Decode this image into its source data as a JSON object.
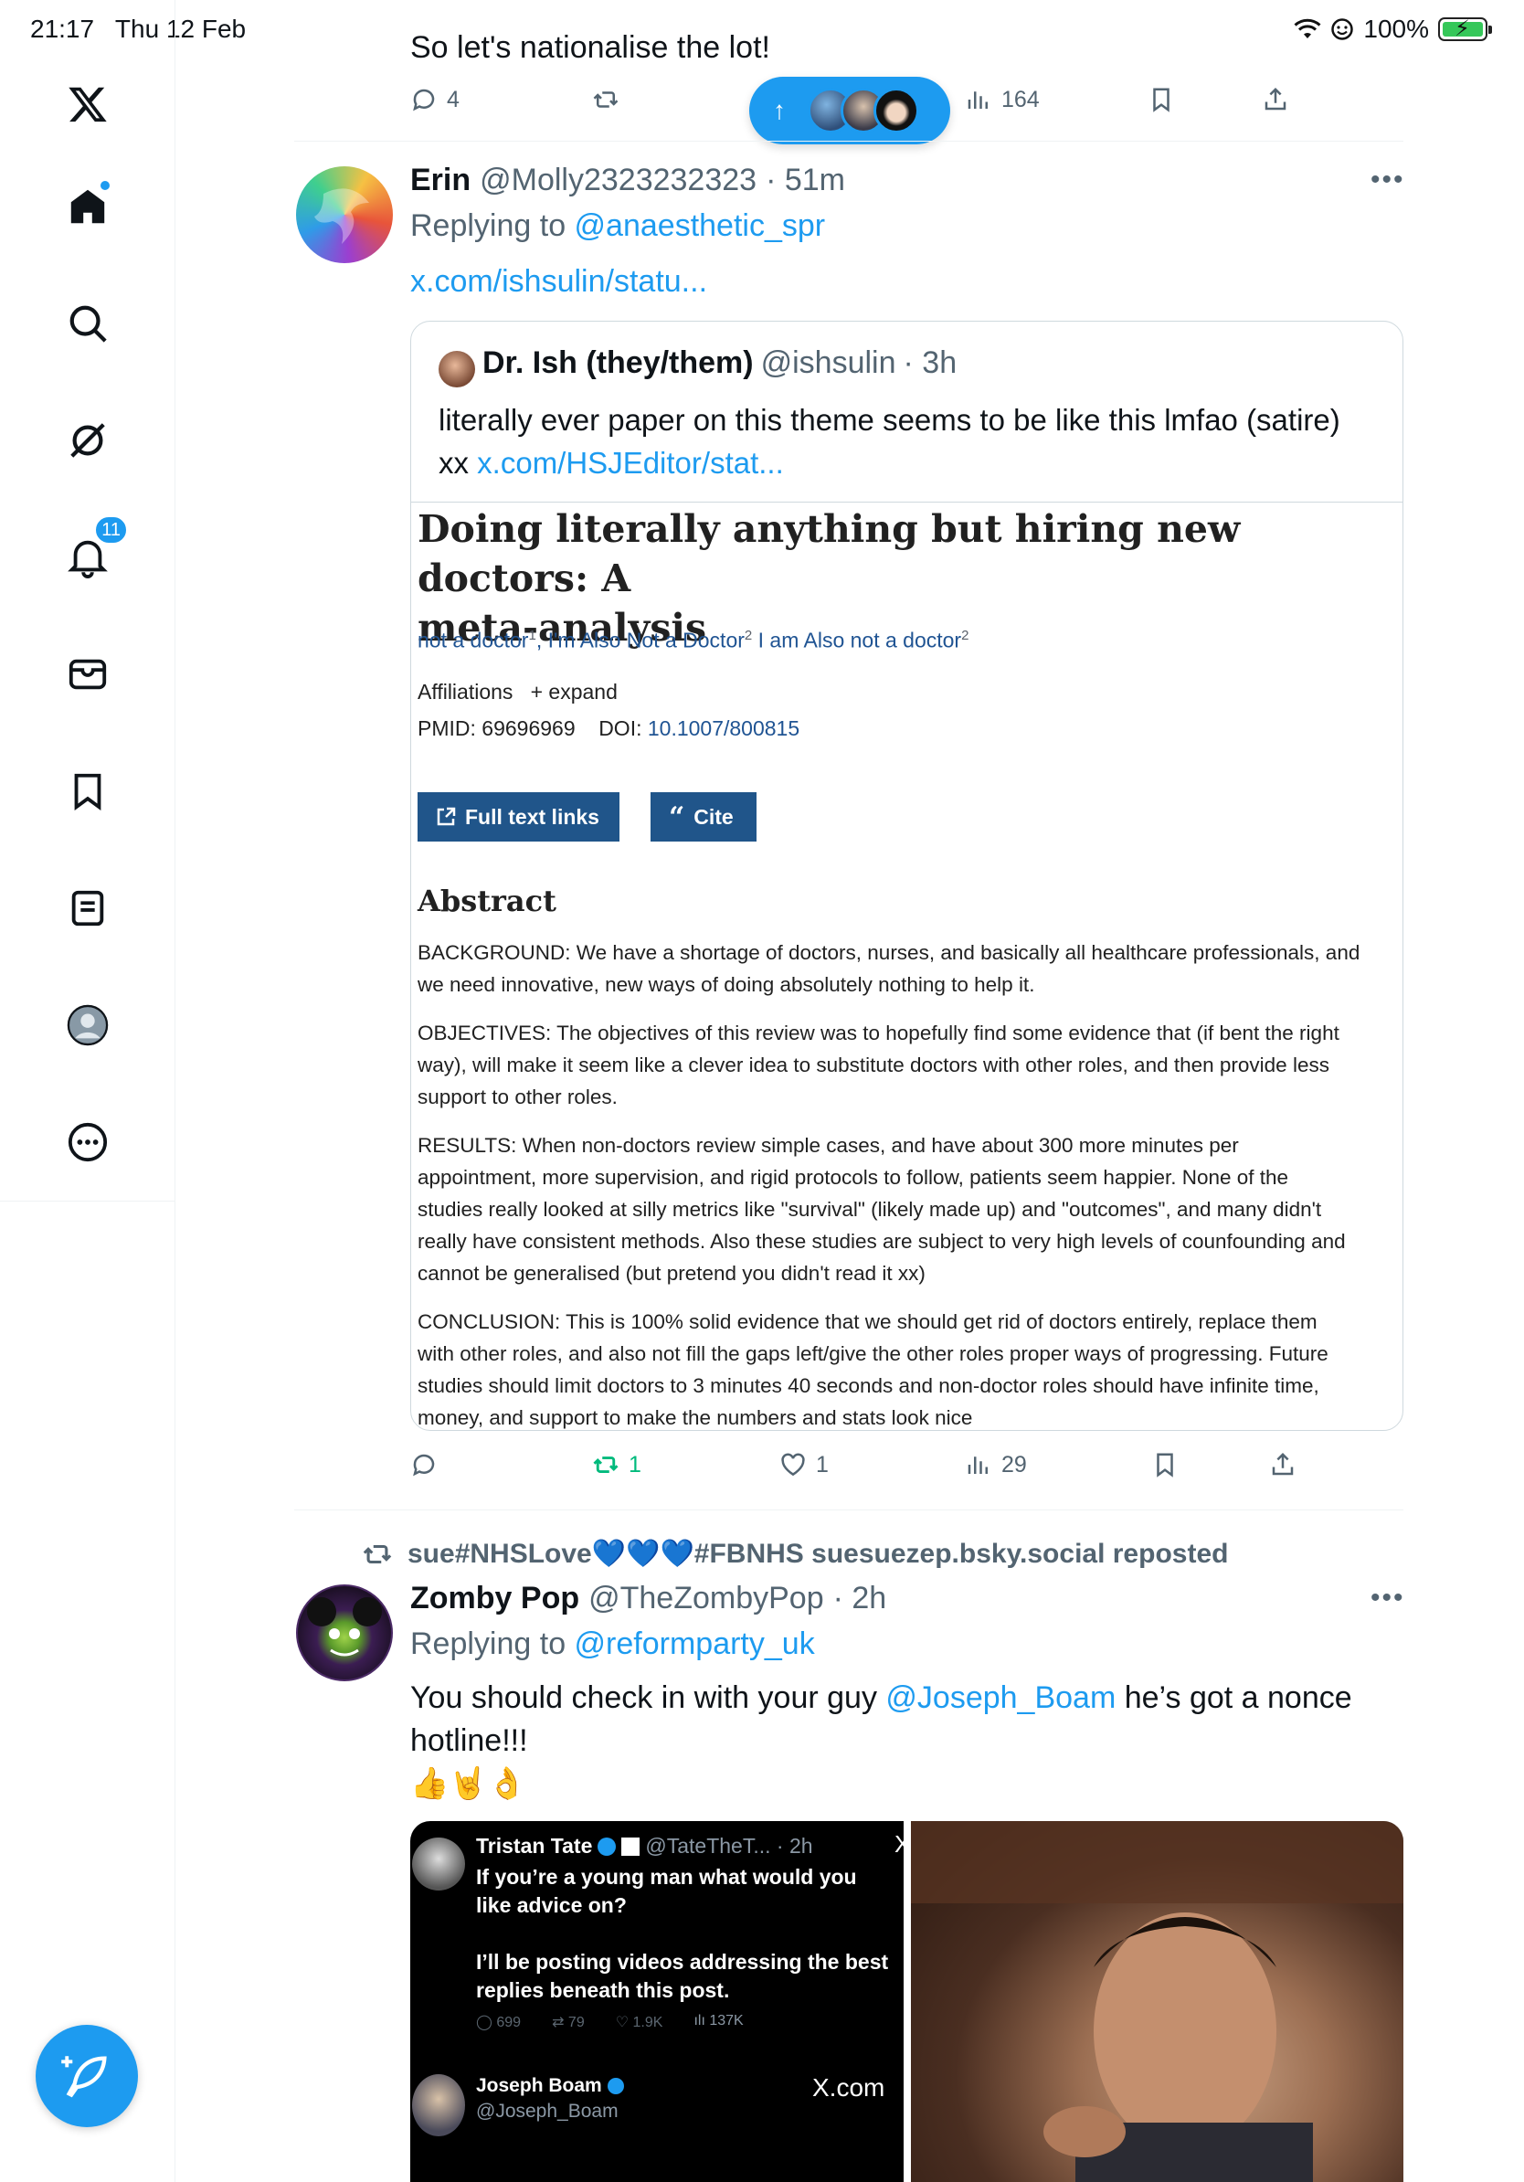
{
  "status_bar": {
    "time": "21:17",
    "date": "Thu 12 Feb",
    "battery": "100%"
  },
  "sidebar": {
    "notifications_badge": "11"
  },
  "new_posts_pill": {
    "arrow": "↑"
  },
  "post0": {
    "text": "So let's nationalise the lot!",
    "replies": "4",
    "views": "164"
  },
  "post1": {
    "name": "Erin",
    "handle": "@Molly2323232323",
    "time": "· 51m",
    "replying_prefix": "Replying to ",
    "replying_to": "@anaesthetic_spr",
    "link": "x.com/ishsulin/statu...",
    "replies": "",
    "reposts": "1",
    "likes": "1",
    "views": "29"
  },
  "quote": {
    "name": "Dr. Ish (they/them)",
    "handle": "@ishsulin",
    "time": "· 3h",
    "text_line1": "literally ever paper on this theme seems to be like this lmfao (satire)",
    "text_line2_prefix": "xx ",
    "text_link": "x.com/HSJEditor/stat...",
    "paper": {
      "title_line1": "Doing literally anything but hiring new doctors: A",
      "title_line2": "meta-analysis",
      "author1": "not a doctor",
      "author1_sup": "1",
      "author2": "I'm Also Not a Doctor",
      "author2_sup": "2",
      "author3": "I am Also not a doctor",
      "author3_sup": "2",
      "affiliations": "Affiliations",
      "expand": "+ expand",
      "pmid_label": "PMID: 69696969",
      "doi_label": "DOI:",
      "doi_value": "10.1007/800815",
      "btn_full_text": "Full text links",
      "btn_cite": "Cite",
      "abstract_heading": "Abstract",
      "background_l1": "BACKGROUND: We have a shortage of doctors, nurses, and basically all healthcare professionals, and",
      "background_l2": "we need innovative, new ways of doing absolutely nothing to help it.",
      "objectives_l1": "OBJECTIVES: The objectives of this review was to hopefully find some evidence that (if bent the right",
      "objectives_l2": "way), will make it seem like a clever idea to substitute doctors with other roles, and then provide less",
      "objectives_l3": "support to other roles.",
      "results_l1": "RESULTS: When non-doctors review simple cases, and have about 300 more minutes per",
      "results_l2": "appointment, more supervision, and rigid protocols to follow, patients seem happier. None of the",
      "results_l3": "studies really looked at silly metrics like \"survival\" (likely made up) and \"outcomes\", and many didn't",
      "results_l4": "really have consistent methods. Also these studies are subject to very high levels of counfounding and",
      "results_l5": "cannot be generalised (but pretend you didn't read it xx)",
      "conclusion_l1": "CONCLUSION: This is 100% solid evidence that we should get rid of doctors entirely, replace them",
      "conclusion_l2": "with other roles, and also not fill the gaps left/give the other roles proper ways of progressing. Future",
      "conclusion_l3": "studies should limit doctors to 3 minutes 40 seconds and non-doctor roles should have infinite time,",
      "conclusion_l4": "money, and support to make the numbers and stats look nice"
    }
  },
  "post2": {
    "repost_line": "sue#NHSLove💙💙💙#FBNHS suesuezep.bsky.social reposted",
    "name": "Zomby Pop",
    "handle": "@TheZombyPop",
    "time": "· 2h",
    "replying_prefix": "Replying to ",
    "replying_to": "@reformparty_uk",
    "text_a": "You should check in with your guy ",
    "text_mention": "@Joseph_Boam",
    "text_b": " he’s got a nonce",
    "text_line2": "hotline!!!",
    "emojis": "👍🤘👌",
    "media": {
      "tweet_name": "Tristan Tate",
      "tweet_handle": "@TateTheT... · 2h",
      "tweet_text1": "If you’re a young man what would you",
      "tweet_text2": "like advice on?",
      "tweet_text3": "I’ll be posting videos addressing the best",
      "tweet_text4": "replies beneath this post.",
      "tweet_replies": "699",
      "tweet_reposts": "79",
      "tweet_likes": "1.9K",
      "tweet_views": "137K",
      "reply_name": "Joseph Boam",
      "reply_handle": "@Joseph_Boam",
      "watermark": "X.com"
    }
  },
  "colors": {
    "accent": "#1d9bf0",
    "repost_green": "#00ba7c",
    "pubmed_button": "#20558a"
  }
}
